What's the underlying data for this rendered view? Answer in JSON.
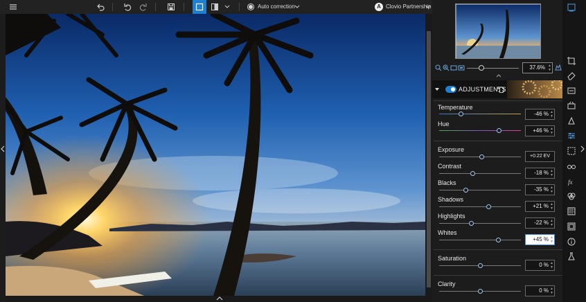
{
  "toolbar": {
    "auto_correction": "Auto correction",
    "account_initial": "A",
    "account_name": "Clovio Partnership"
  },
  "navigator": {
    "zoom_value": "37.6%"
  },
  "adjustments": {
    "title": "ADJUSTMENTS",
    "sliders": [
      {
        "label": "Temperature",
        "value": "-46 %",
        "level": -0.46
      },
      {
        "label": "Hue",
        "value": "+46 %",
        "level": 0.46
      },
      {
        "label": "Exposure",
        "value": "+0.22 EV",
        "level": 0.04
      },
      {
        "label": "Contrast",
        "value": "-18 %",
        "level": -0.18
      },
      {
        "label": "Blacks",
        "value": "-35 %",
        "level": -0.35
      },
      {
        "label": "Shadows",
        "value": "+21 %",
        "level": 0.21
      },
      {
        "label": "Highlights",
        "value": "-22 %",
        "level": -0.22
      },
      {
        "label": "Whites",
        "value": "+45 %",
        "level": 0.45
      },
      {
        "label": "Saturation",
        "value": "0 %",
        "level": 0
      },
      {
        "label": "Clarity",
        "value": "0 %",
        "level": 0
      }
    ]
  },
  "colors": {
    "accent": "#1f7fd0",
    "toolbar_bg": "#222222",
    "panel_bg": "#1c1c1c"
  },
  "icons": [
    "menu-icon",
    "undo-icon",
    "redo-icon",
    "redo-alt-icon",
    "save-icon",
    "single-view-icon",
    "compare-view-icon",
    "chevron-down-icon",
    "user-icon",
    "zoom-in-icon",
    "zoom-out-icon",
    "fit-icon",
    "histogram-icon",
    "gear-icon"
  ]
}
